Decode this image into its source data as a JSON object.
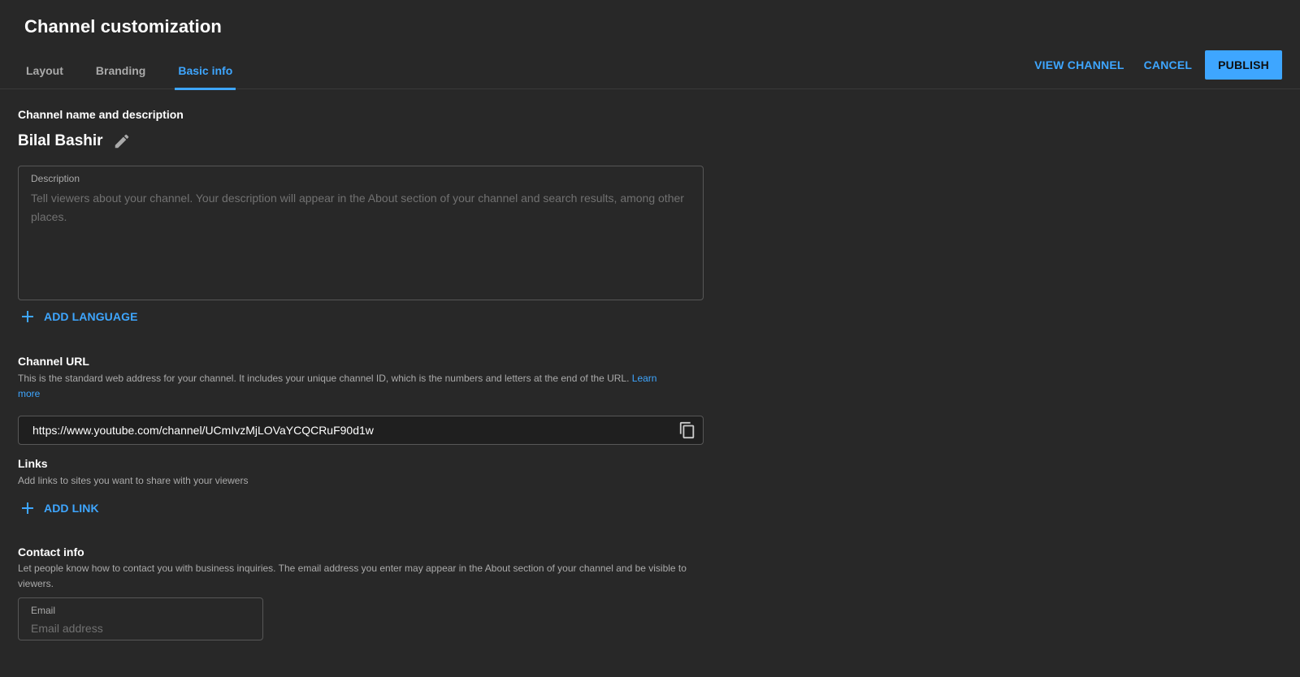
{
  "header": {
    "title": "Channel customization",
    "tabs": [
      {
        "label": "Layout",
        "active": false
      },
      {
        "label": "Branding",
        "active": false
      },
      {
        "label": "Basic info",
        "active": true
      }
    ],
    "actions": {
      "view_channel": "VIEW CHANNEL",
      "cancel": "CANCEL",
      "publish": "PUBLISH"
    }
  },
  "name_section": {
    "title": "Channel name and description",
    "channel_name": "Bilal Bashir",
    "edit_icon": "pencil-icon",
    "description": {
      "label": "Description",
      "value": "",
      "placeholder": "Tell viewers about your channel. Your description will appear in the About section of your channel and search results, among other places."
    },
    "add_language": "ADD LANGUAGE"
  },
  "url_section": {
    "title": "Channel URL",
    "description": "This is the standard web address for your channel. It includes your unique channel ID, which is the numbers and letters at the end of the URL.",
    "learn_more": "Learn more",
    "url": "https://www.youtube.com/channel/UCmIvzMjLOVaYCQCRuF90d1w",
    "copy_icon": "copy-icon"
  },
  "links_section": {
    "title": "Links",
    "description": "Add links to sites you want to share with your viewers",
    "add_link": "ADD LINK"
  },
  "contact_section": {
    "title": "Contact info",
    "description": "Let people know how to contact you with business inquiries. The email address you enter may appear in the About section of your channel and be visible to viewers.",
    "email": {
      "label": "Email",
      "value": "",
      "placeholder": "Email address"
    }
  },
  "colors": {
    "background": "#282828",
    "accent": "#3ea6ff",
    "text_primary": "#ffffff",
    "text_secondary": "#aaaaaa",
    "border": "#575757"
  }
}
